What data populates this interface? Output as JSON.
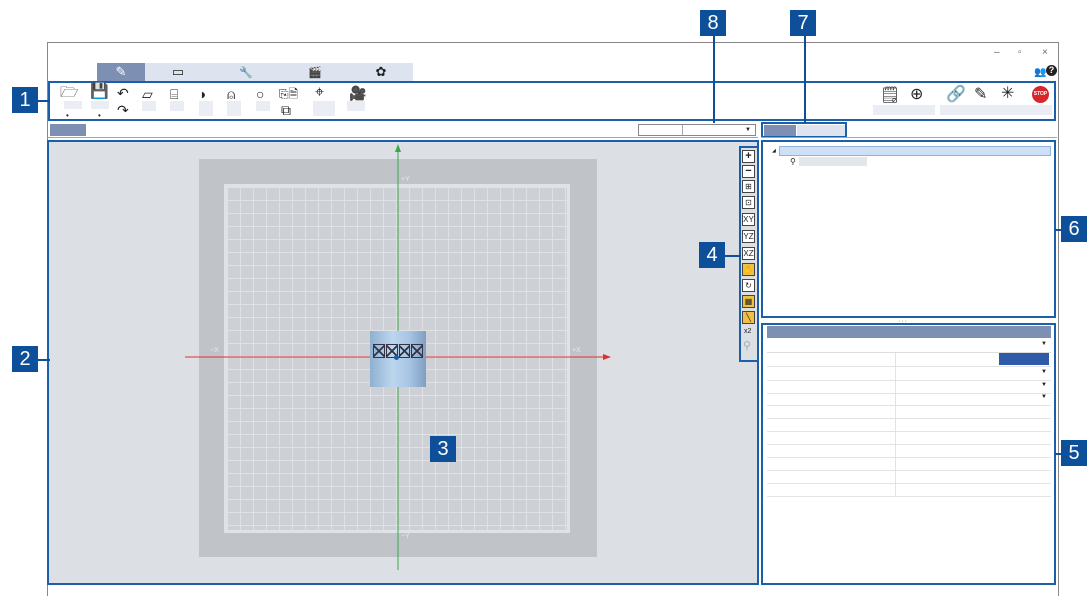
{
  "callouts": {
    "c1": "1",
    "c2": "2",
    "c3": "3",
    "c4": "4",
    "c5": "5",
    "c6": "6",
    "c7": "7",
    "c8": "8"
  },
  "window": {
    "min": "–",
    "restore": "▫",
    "close": "×"
  },
  "tabs": [
    {
      "icon": "edit-icon",
      "glyph": "✎"
    },
    {
      "icon": "monitor-icon",
      "glyph": "▭"
    },
    {
      "icon": "wrench-icon",
      "glyph": "🔧"
    },
    {
      "icon": "clapper-icon",
      "glyph": "🎬"
    },
    {
      "icon": "gear-icon",
      "glyph": "✿"
    }
  ],
  "help": {
    "glyph": "?"
  },
  "toolbar": {
    "open": "🗁",
    "save": "💾",
    "undo": "↶",
    "redo": "↷",
    "shape1": "▱",
    "shape2": "⌸",
    "shape3": "◗",
    "shape4": "⍝",
    "shape5": "○",
    "copy": "⧉",
    "crosshair": "⌖",
    "camera": "🎥"
  },
  "right_toolbar": {
    "r1": "🗒",
    "r2": "⊕",
    "r3": "🔗",
    "r4": "✎",
    "r5": "✳",
    "stop": "STOP"
  },
  "viewport": {
    "axis_px": "+Y",
    "axis_nx": "−X",
    "axis_ppx": "+X",
    "axis_ny": "−Y"
  },
  "view_tools": [
    "+",
    "−",
    "⊞",
    "⊡",
    "XY",
    "YZ",
    "XZ",
    "✋",
    "↻",
    "▦",
    "╲",
    "x2",
    "⚲"
  ],
  "colors": {
    "accent": "#1b5fab",
    "tab_active": "#7d8fb2",
    "x_axis": "#e03030",
    "y_axis": "#3aa84a"
  }
}
